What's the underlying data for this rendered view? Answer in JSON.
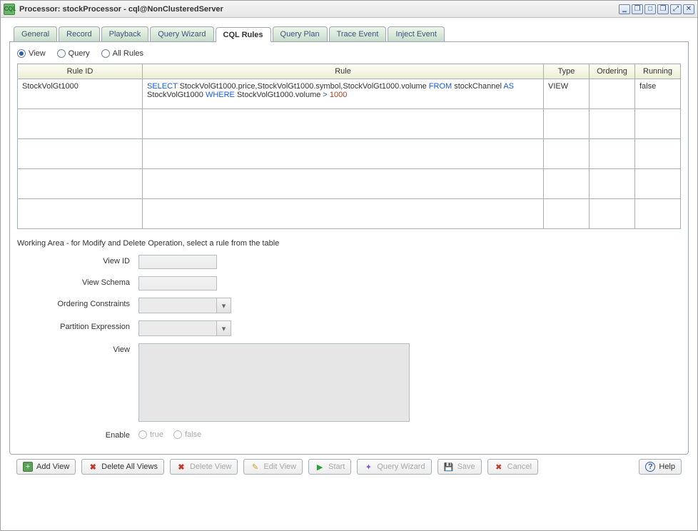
{
  "window": {
    "title": "Processor: stockProcessor - cql@NonClusteredServer",
    "logo_text": "CQL"
  },
  "tabs": [
    "General",
    "Record",
    "Playback",
    "Query Wizard",
    "CQL Rules",
    "Query Plan",
    "Trace Event",
    "Inject Event"
  ],
  "active_tab": "CQL Rules",
  "filters": {
    "view": "View",
    "query": "Query",
    "all": "All Rules",
    "selected": "view"
  },
  "table": {
    "headers": {
      "rule_id": "Rule ID",
      "rule": "Rule",
      "type": "Type",
      "ordering": "Ordering",
      "running": "Running"
    },
    "rows": [
      {
        "rule_id": "StockVolGt1000",
        "rule_tokens": [
          {
            "t": "kw",
            "v": "SELECT"
          },
          {
            "t": "txt",
            "v": " StockVolGt1000.price,StockVolGt1000.symbol,StockVolGt1000.volume "
          },
          {
            "t": "kw",
            "v": "FROM"
          },
          {
            "t": "txt",
            "v": " stockChannel "
          },
          {
            "t": "kw",
            "v": "AS"
          },
          {
            "t": "txt",
            "v": " StockVolGt1000 "
          },
          {
            "t": "kw",
            "v": "WHERE"
          },
          {
            "t": "txt",
            "v": " StockVolGt1000.volume "
          },
          {
            "t": "kw",
            "v": ">"
          },
          {
            "t": "txt",
            "v": " "
          },
          {
            "t": "num",
            "v": "1000"
          }
        ],
        "type": "VIEW",
        "ordering": "",
        "running": "false"
      }
    ]
  },
  "working_area_label": "Working Area - for Modify and Delete Operation, select a rule from the table",
  "form": {
    "view_id_label": "View ID",
    "view_schema_label": "View Schema",
    "ordering_label": "Ordering Constraints",
    "partition_label": "Partition Expression",
    "view_label": "View",
    "enable_label": "Enable",
    "enable_true": "true",
    "enable_false": "false"
  },
  "buttons": {
    "add_view": "Add View",
    "delete_all": "Delete All Views",
    "delete_view": "Delete View",
    "edit_view": "Edit View",
    "start": "Start",
    "query_wizard": "Query Wizard",
    "save": "Save",
    "cancel": "Cancel",
    "help": "Help"
  }
}
